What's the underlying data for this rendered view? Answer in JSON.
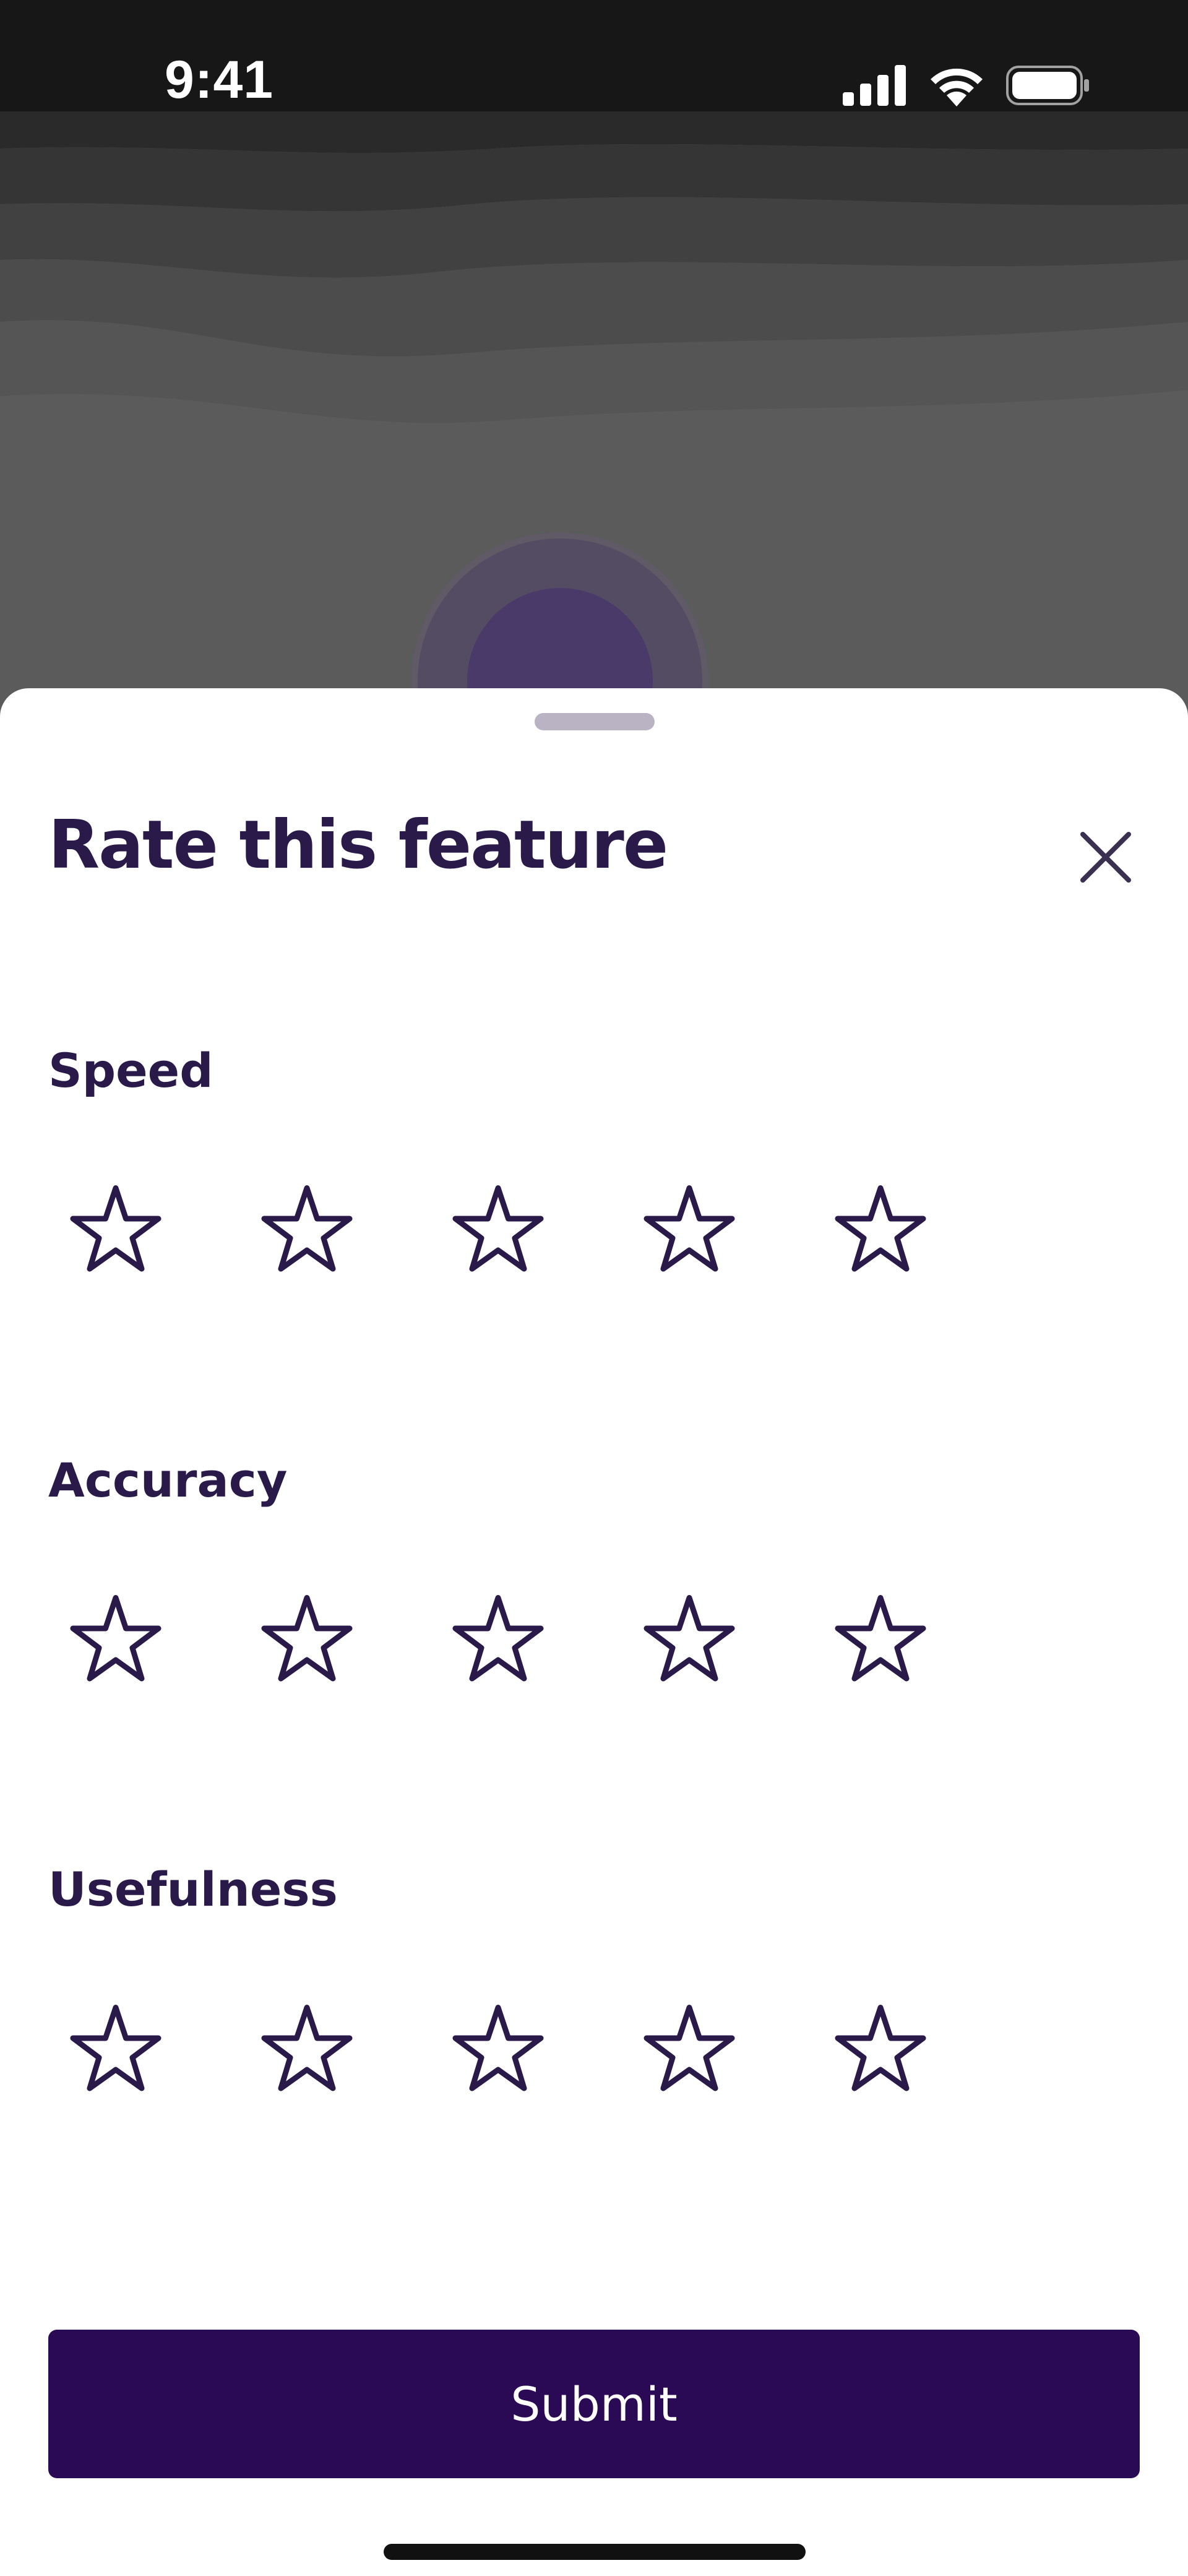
{
  "status_bar": {
    "time": "9:41",
    "icons": [
      "cellular-signal-icon",
      "wifi-icon",
      "battery-icon"
    ]
  },
  "sheet": {
    "title": "Rate this feature",
    "close_icon": "close-icon",
    "sections": [
      {
        "label": "Speed",
        "rating": 0,
        "max_rating": 5
      },
      {
        "label": "Accuracy",
        "rating": 0,
        "max_rating": 5
      },
      {
        "label": "Usefulness",
        "rating": 0,
        "max_rating": 5
      }
    ],
    "submit_label": "Submit"
  },
  "colors": {
    "title_text": "#2a1a4a",
    "star_outline": "#2a1a4a",
    "submit_background": "#2a0a55",
    "submit_text": "#ffffff",
    "grabber": "#b9b3c4",
    "status_bar_background": "#171717",
    "backdrop": "#5b5b5b",
    "backdrop_accent": "#4a3a6a"
  }
}
